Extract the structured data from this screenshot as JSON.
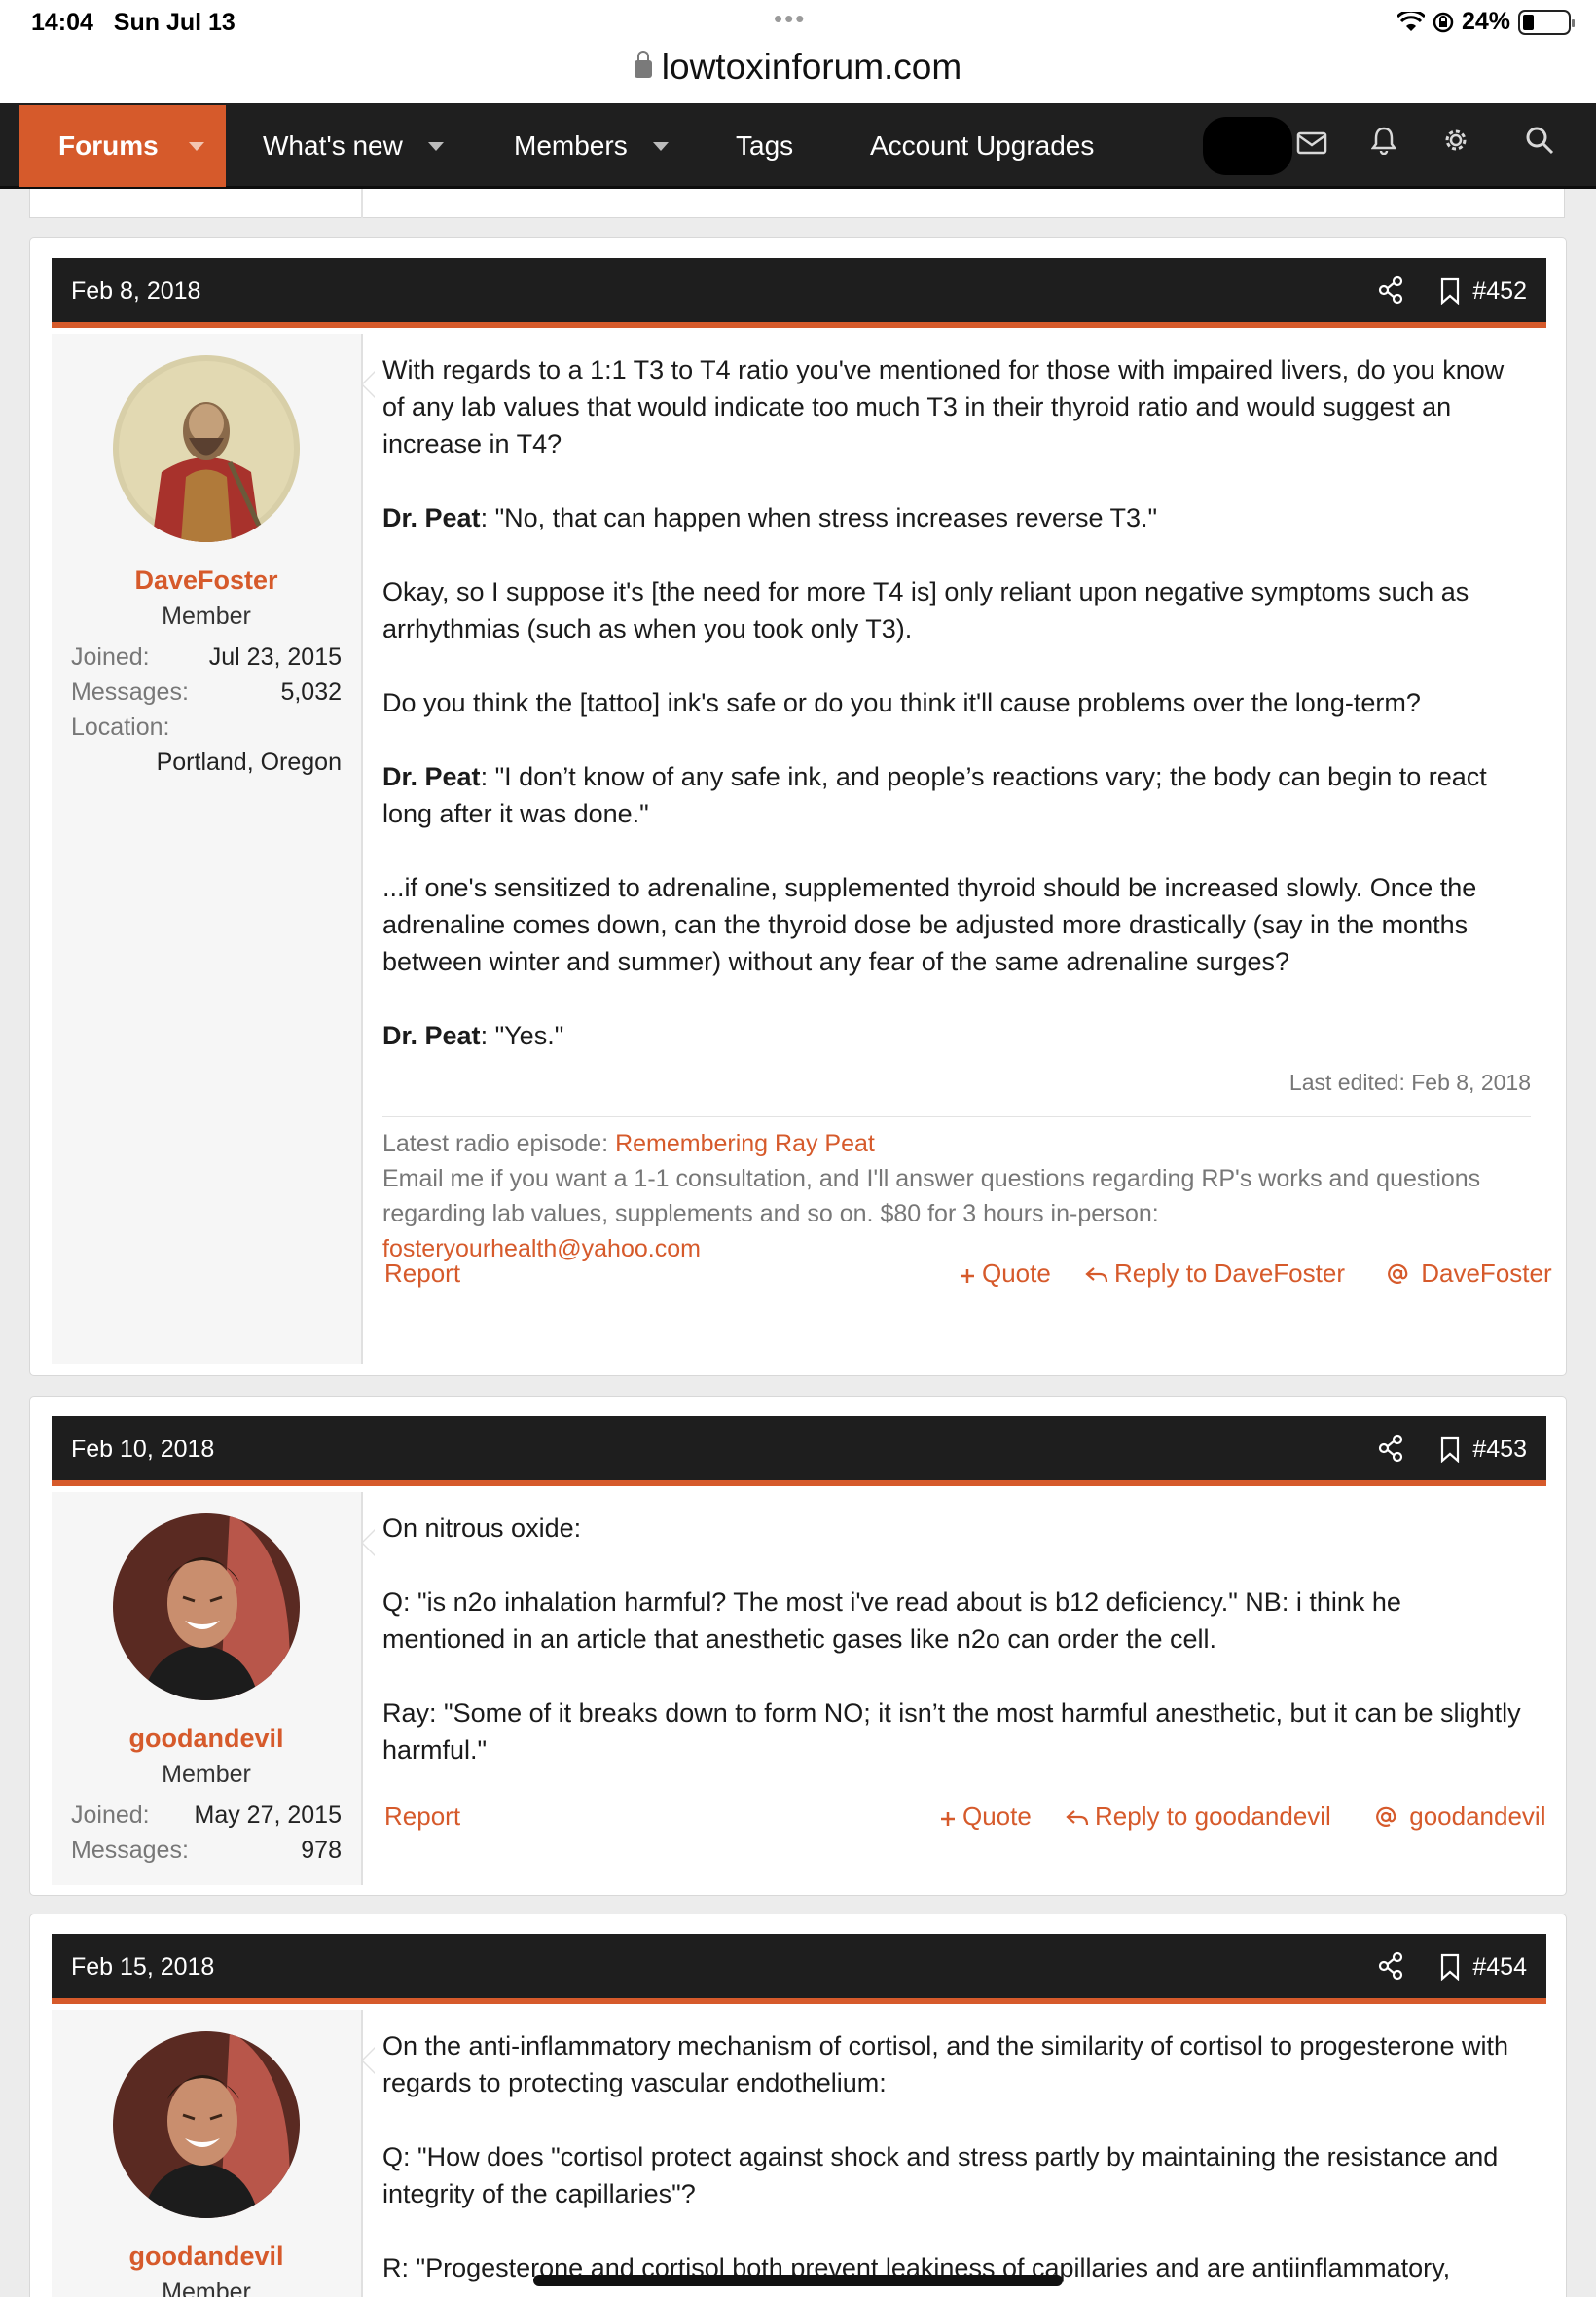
{
  "status_bar": {
    "time": "14:04",
    "date": "Sun Jul 13",
    "battery": "24%"
  },
  "browser": {
    "url": "lowtoxinforum.com"
  },
  "nav": {
    "items": [
      {
        "label": "Forums"
      },
      {
        "label": "What's new"
      },
      {
        "label": "Members"
      },
      {
        "label": "Tags"
      },
      {
        "label": "Account Upgrades"
      }
    ]
  },
  "posts": [
    {
      "date": "Feb 8, 2018",
      "number": "#452",
      "user": {
        "name": "DaveFoster",
        "role": "Member",
        "joined_label": "Joined:",
        "joined": "Jul 23, 2015",
        "messages_label": "Messages:",
        "messages": "5,032",
        "location_label": "Location:",
        "location": "Portland, Oregon"
      },
      "paragraphs": [
        {
          "text": "With regards to a 1:1 T3 to T4 ratio you've mentioned for those with impaired livers, do you know of any lab values that would indicate too much T3 in their thyroid ratio and would suggest an increase in T4?"
        },
        {
          "bold": "Dr. Peat",
          "text": ": \"No, that can happen when stress increases reverse T3.\""
        },
        {
          "text": "Okay, so I suppose it's [the need for more T4 is] only reliant upon negative symptoms such as arrhythmias (such as when you took only T3)."
        },
        {
          "text": "Do you think the [tattoo] ink's safe or do you think it'll cause problems over the long-term?"
        },
        {
          "bold": "Dr. Peat",
          "text": ": \"I don’t know of any safe ink, and people’s reactions vary; the body can begin to react long after it was done.\""
        },
        {
          "text": "...if one's sensitized to adrenaline, supplemented thyroid should be increased slowly. Once the adrenaline comes down, can the thyroid dose be adjusted more drastically (say in the months between winter and summer) without any fear of the same adrenaline surges?"
        },
        {
          "bold": "Dr. Peat",
          "text": ": \"Yes.\""
        }
      ],
      "last_edited": "Last edited: Feb 8, 2018",
      "signature": {
        "prefix": "Latest radio episode: ",
        "link": "Remembering Ray Peat",
        "line2": "Email me if you want a 1-1 consultation, and I'll answer questions regarding RP's works and questions regarding lab values, supplements and so on. $80 for 3 hours in-person:",
        "email": "fosteryourhealth@yahoo.com"
      },
      "actions": {
        "report": "Report",
        "quote": "Quote",
        "reply": "Reply to DaveFoster",
        "mention": "DaveFoster"
      }
    },
    {
      "date": "Feb 10, 2018",
      "number": "#453",
      "user": {
        "name": "goodandevil",
        "role": "Member",
        "joined_label": "Joined:",
        "joined": "May 27, 2015",
        "messages_label": "Messages:",
        "messages": "978"
      },
      "paragraphs": [
        {
          "text": "On nitrous oxide:"
        },
        {
          "text": "Q: \"is n2o inhalation harmful? The most i've read about is b12 deficiency.\" NB: i think he mentioned in an article that anesthetic gases like n2o can order the cell."
        },
        {
          "text": "Ray: \"Some of it breaks down to form NO; it isn’t the most harmful anesthetic, but it can be slightly harmful.\""
        }
      ],
      "actions": {
        "report": "Report",
        "quote": "Quote",
        "reply": "Reply to goodandevil",
        "mention": "goodandevil"
      }
    },
    {
      "date": "Feb 15, 2018",
      "number": "#454",
      "user": {
        "name": "goodandevil",
        "role": "Member"
      },
      "paragraphs": [
        {
          "text": "On the anti-inflammatory mechanism of cortisol, and the similarity of cortisol to progesterone with regards to protecting vascular endothelium:"
        },
        {
          "text": "Q: \"How does \"cortisol protect against shock and stress partly by maintaining the resistance and integrity of the capillaries\"?"
        },
        {
          "text": "R: \"Progesterone and cortisol both prevent leakiness of capillaries and are antiinflammatory,"
        }
      ]
    }
  ]
}
